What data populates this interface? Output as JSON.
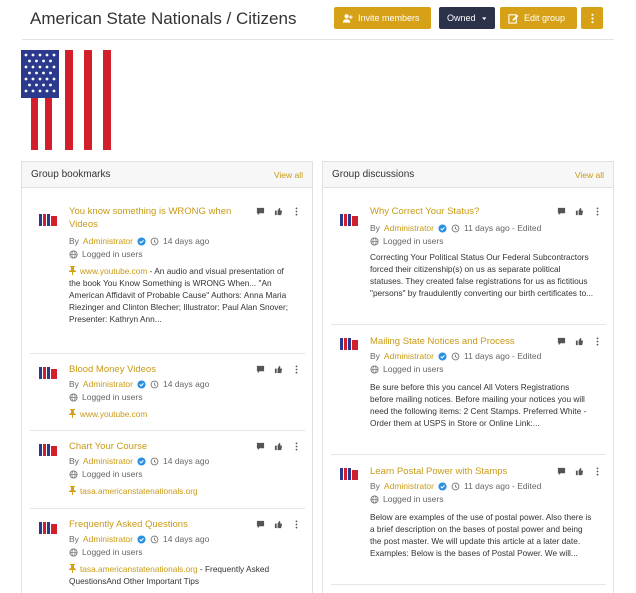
{
  "header": {
    "title": "American State Nationals / Citizens",
    "invite_label": "Invite members",
    "owned_label": "Owned",
    "edit_label": "Edit group"
  },
  "bookmarks": {
    "title": "Group bookmarks",
    "view_all": "View all",
    "items": [
      {
        "title": "You know something is WRONG when Videos",
        "author": "Administrator",
        "time": "14 days ago",
        "visibility": "Logged in users",
        "link": "www.youtube.com",
        "description": " - An audio and visual presentation of the book You Know Something is WRONG When... \"An American Affidavit of Probable Cause\"  Authors: Anna Maria Riezinger and Clinton Blecher;  Illustrator: Paul Alan Snover; Presenter: Kathryn Ann..."
      },
      {
        "title": "Blood Money Videos",
        "author": "Administrator",
        "time": "14 days ago",
        "visibility": "Logged in users",
        "link": "www.youtube.com",
        "description": ""
      },
      {
        "title": "Chart Your Course",
        "author": "Administrator",
        "time": "14 days ago",
        "visibility": "Logged in users",
        "link": "tasa.americanstatenationals.org",
        "description": ""
      },
      {
        "title": "Frequently Asked Questions",
        "author": "Administrator",
        "time": "14 days ago",
        "visibility": "Logged in users",
        "link": "tasa.americanstatenationals.org",
        "description": " - Frequently Asked QuestionsAnd Other Important Tips"
      }
    ]
  },
  "discussions": {
    "title": "Group discussions",
    "view_all": "View all",
    "items": [
      {
        "title": "Why Correct Your Status?",
        "author": "Administrator",
        "time": "11 days ago - Edited",
        "visibility": "Logged in users",
        "excerpt": "Correcting Your Political Status Our Federal Subcontractors forced their citizenship(s) on us as separate political statuses. They created false registrations for us as fictitious \"persons\" by fraudulently converting our birth certificates to..."
      },
      {
        "title": "Mailing State Notices and Process",
        "author": "Administrator",
        "time": "11 days ago - Edited",
        "visibility": "Logged in users",
        "excerpt": "Be sure before this you cancel All Voters Registrations before mailing notices.  Before mailing your notices you will need the following items: 2 Cent Stamps. Preferred White - Order them at USPS in Store or Online Link:..."
      },
      {
        "title": "Learn Postal Power with Stamps",
        "author": "Administrator",
        "time": "11 days ago - Edited",
        "visibility": "Logged in users",
        "excerpt": "Below are examples of the use of postal power. Also there is a brief description on the bases of postal power and being the post master. We will update this article at a later date. Examples: Below is the bases of Postal Power. We will..."
      }
    ]
  },
  "colors": {
    "accent": "#d6a116",
    "dark_button": "#2c3249",
    "link": "#c99a15",
    "verified": "#2b8fe0"
  }
}
